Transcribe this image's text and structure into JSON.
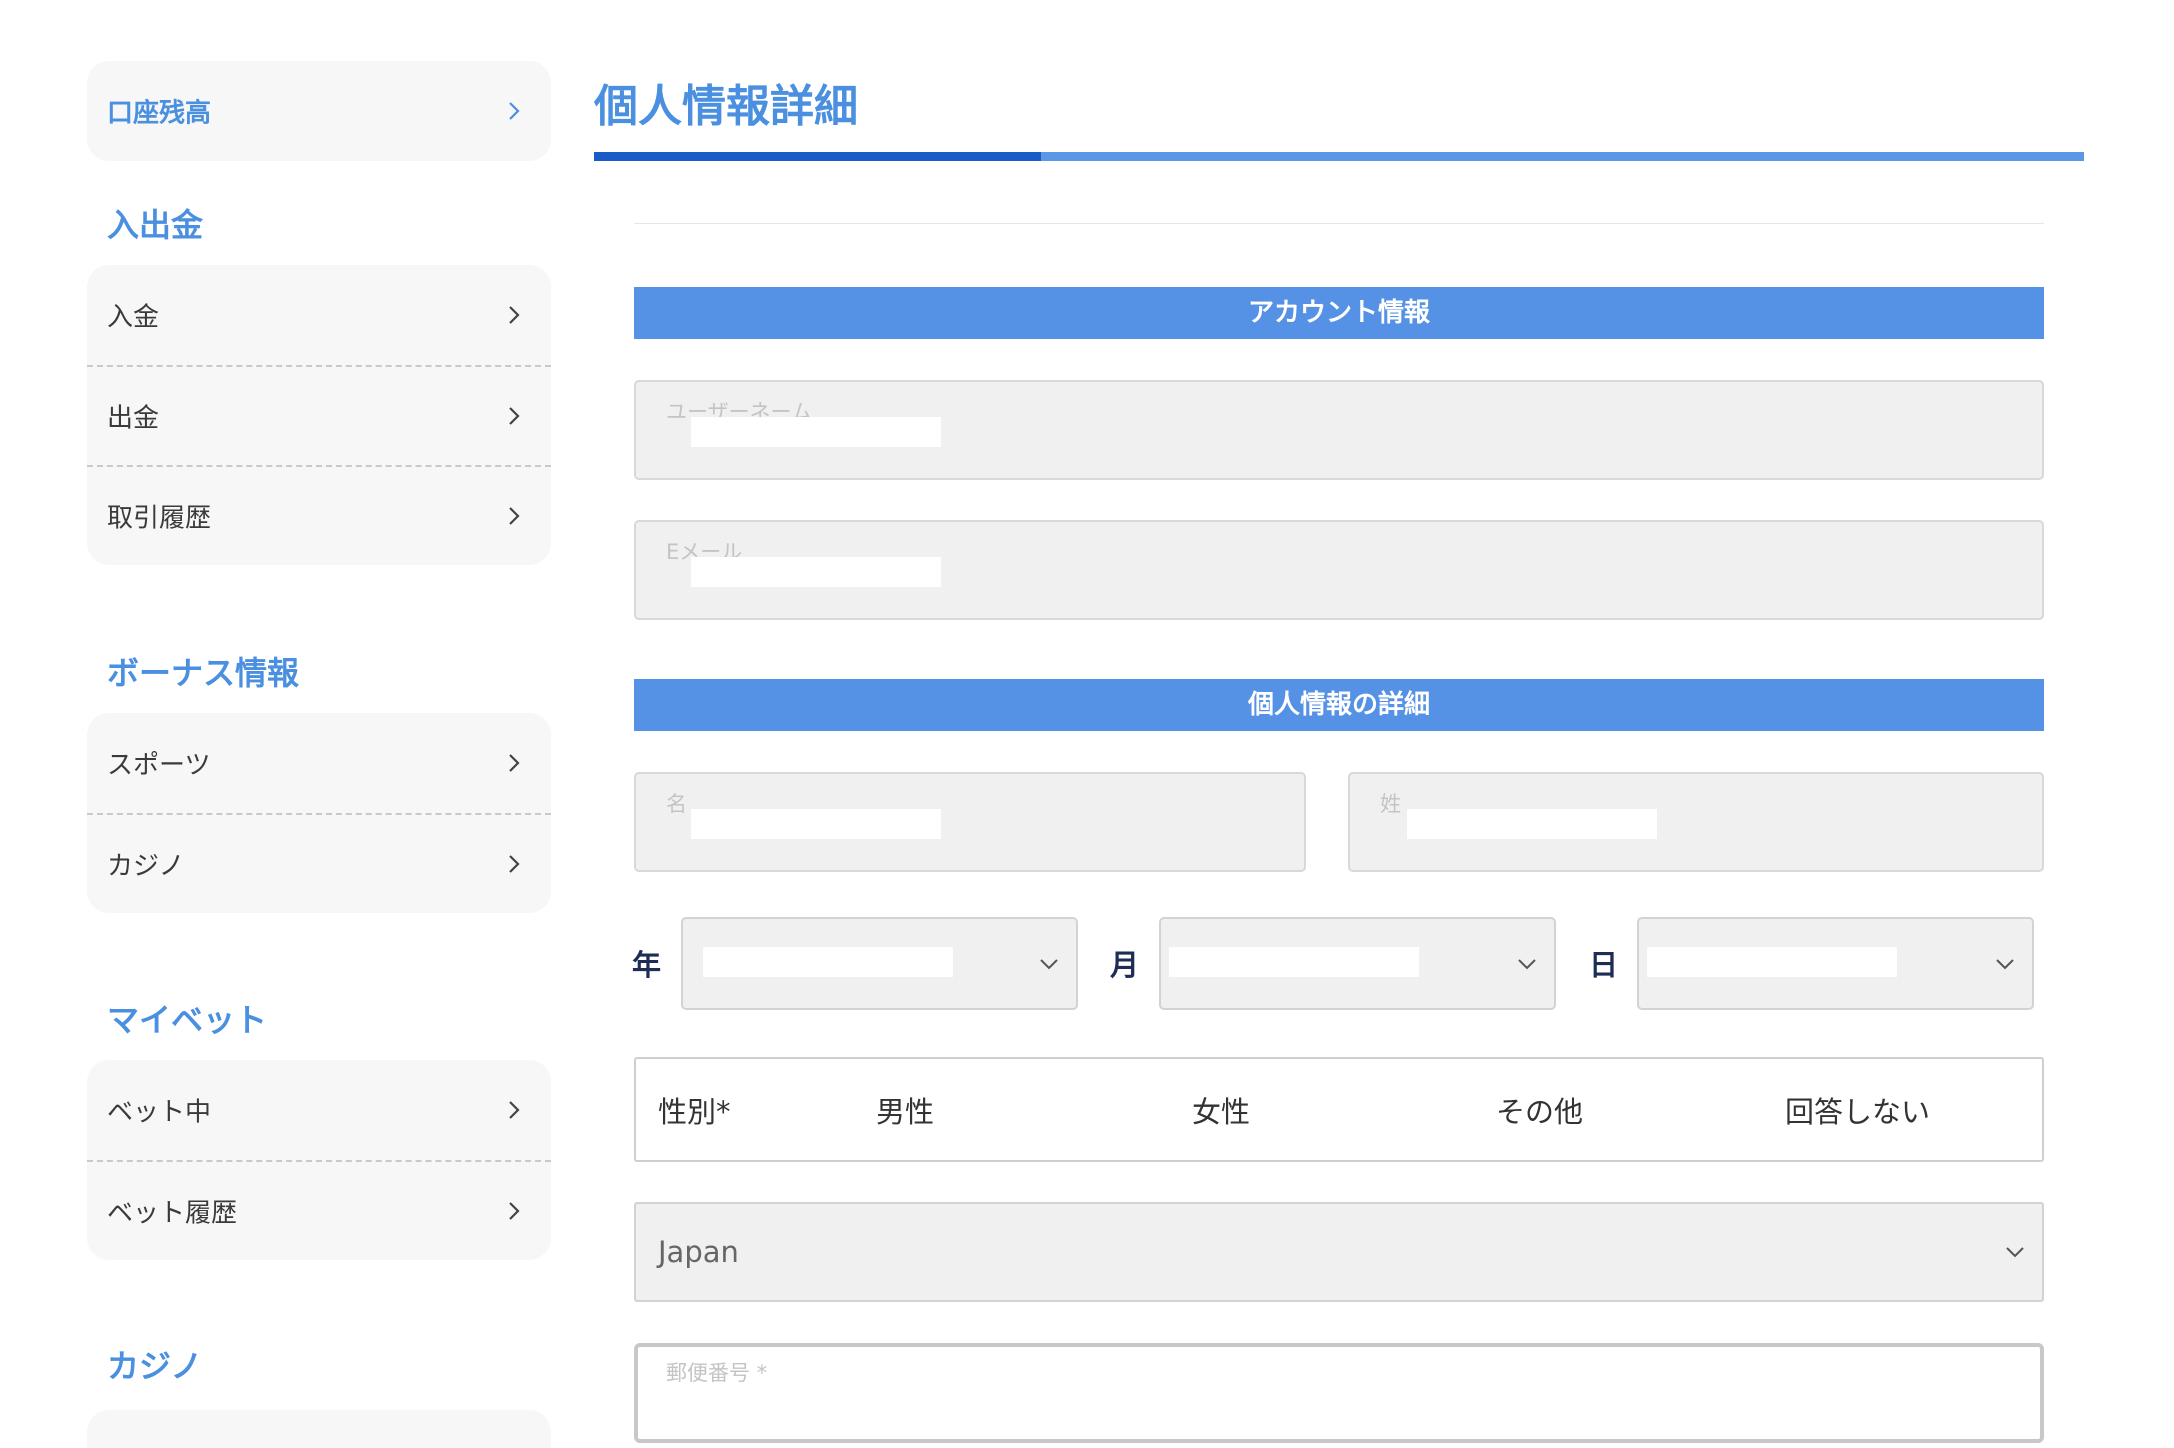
{
  "sidebar": {
    "account_balance": "口座残高",
    "deposit_section": {
      "title": "入出金",
      "items": [
        "入金",
        "出金",
        "取引履歴"
      ]
    },
    "bonus_section": {
      "title": "ボーナス情報",
      "items": [
        "スポーツ",
        "カジノ"
      ]
    },
    "mybet_section": {
      "title": "マイベット",
      "items": [
        "ベット中",
        "ベット履歴"
      ]
    },
    "casino_section": {
      "title": "カジノ"
    }
  },
  "main": {
    "title": "個人情報詳細",
    "progress_percent": 30,
    "account_band": "アカウント情報",
    "username_label": "ユーザーネーム",
    "email_label": "Eメール",
    "personal_band": "個人情報の詳細",
    "first_name_label": "名",
    "last_name_label": "姓",
    "dob": {
      "year_label": "年",
      "month_label": "月",
      "day_label": "日"
    },
    "gender": {
      "label": "性別*",
      "options": [
        "男性",
        "女性",
        "その他",
        "回答しない"
      ]
    },
    "country_value": "Japan",
    "postal_label": "郵便番号 *"
  },
  "colors": {
    "accent": "#4a8fe0",
    "band": "#5592e6",
    "progress_fill": "#1a5cc7",
    "progress_track": "#5b97e4"
  }
}
